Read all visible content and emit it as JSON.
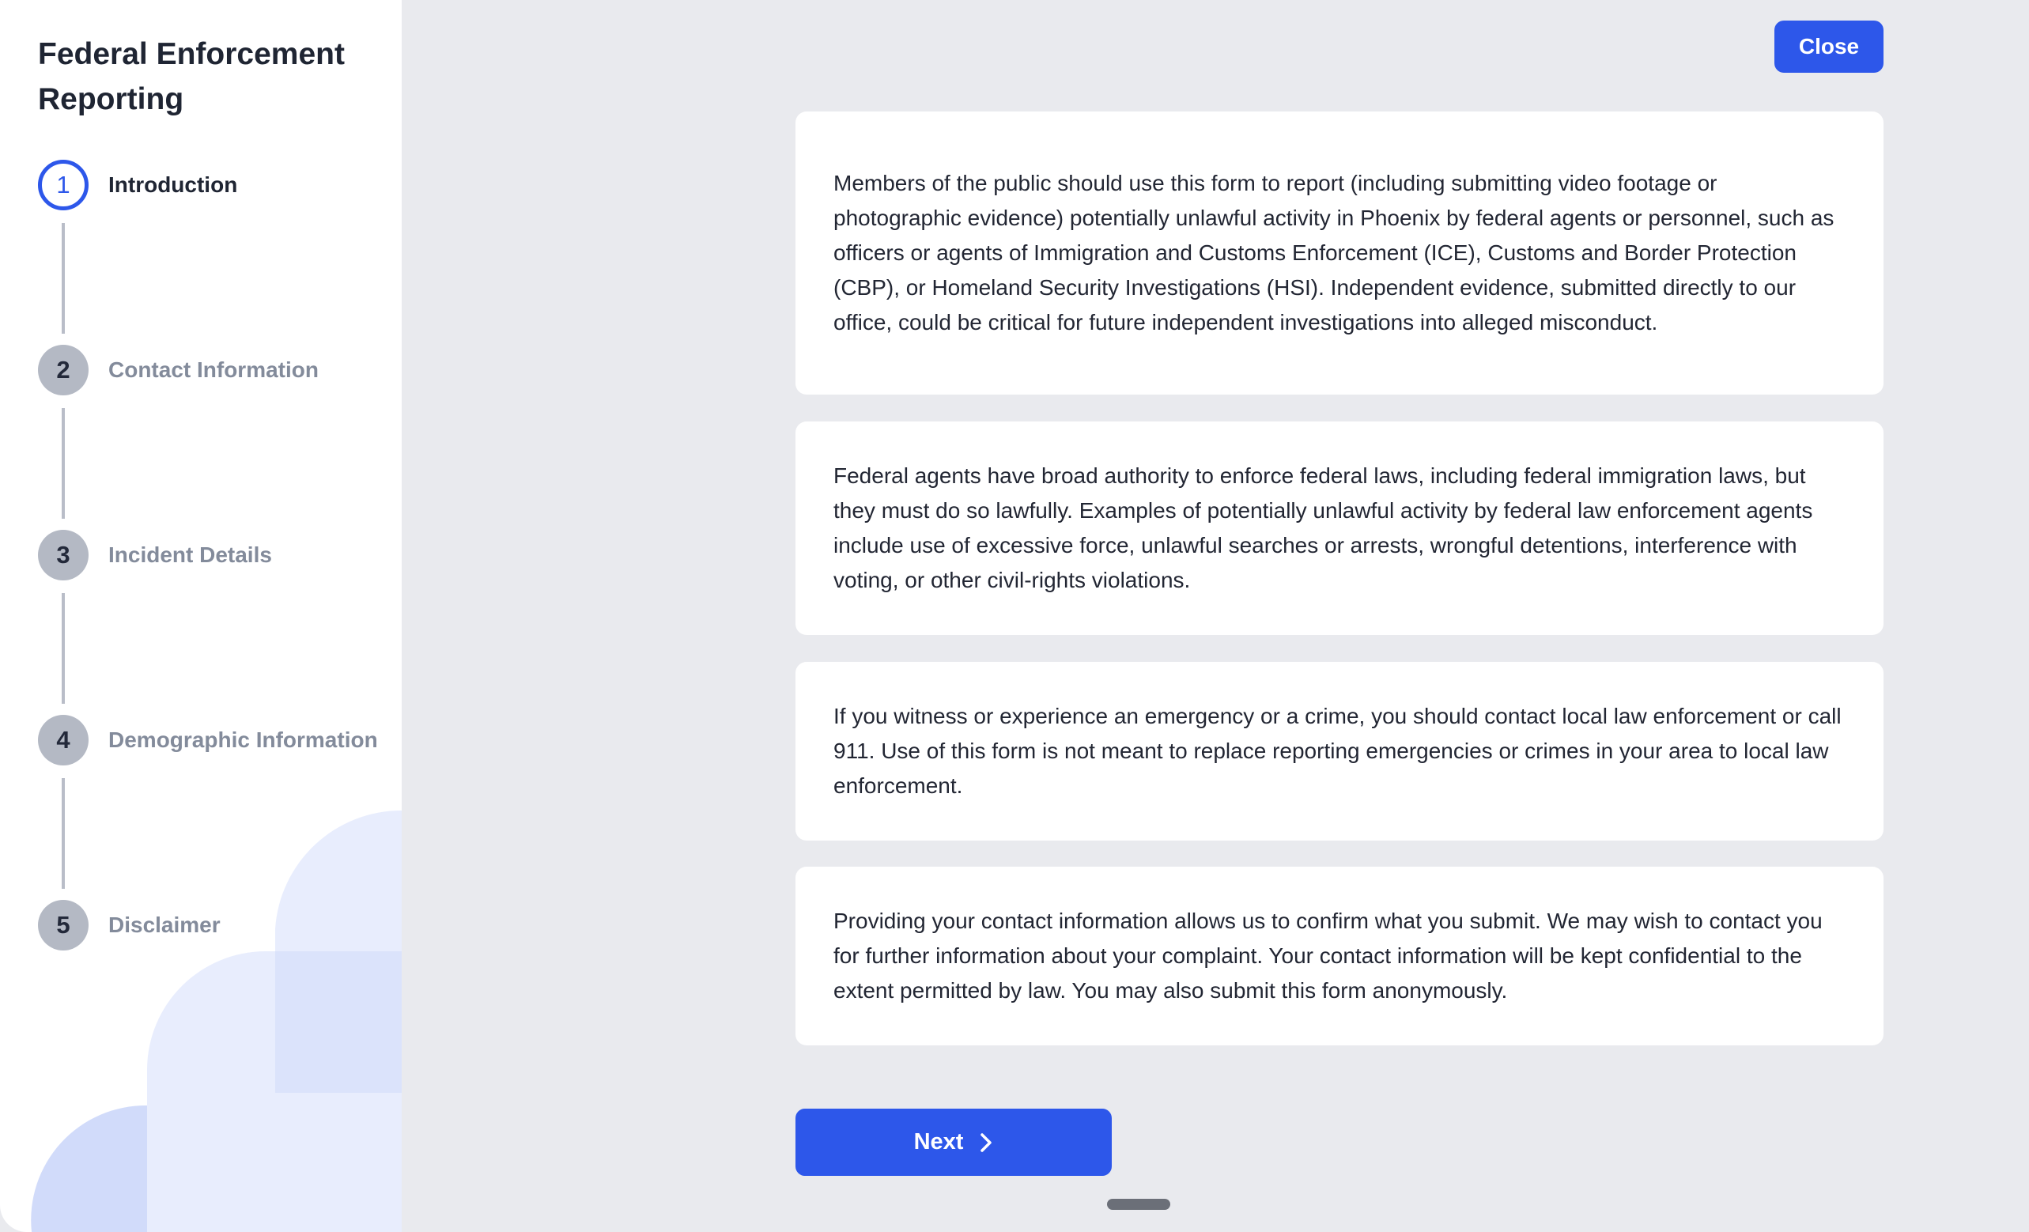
{
  "sidebar": {
    "title": "Federal Enforcement Reporting",
    "steps": [
      {
        "number": "1",
        "label": "Introduction",
        "state": "active"
      },
      {
        "number": "2",
        "label": "Contact Information",
        "state": "inactive"
      },
      {
        "number": "3",
        "label": "Incident Details",
        "state": "inactive"
      },
      {
        "number": "4",
        "label": "Demographic Information",
        "state": "inactive"
      },
      {
        "number": "5",
        "label": "Disclaimer",
        "state": "inactive"
      }
    ]
  },
  "header": {
    "close_label": "Close"
  },
  "main": {
    "paragraphs": [
      "Members of the public should use this form to report (including submitting video footage or photographic evidence) potentially unlawful activity in Phoenix by federal agents or personnel, such as officers or agents of Immigration and Customs Enforcement (ICE), Customs and Border Protection (CBP), or Homeland Security Investigations (HSI). Independent evidence, submitted directly to our office, could be critical for future independent investigations into alleged misconduct.",
      "Federal agents have broad authority to enforce federal laws, including federal immigration laws, but they must do so lawfully. Examples of potentially unlawful activity by federal law enforcement agents include use of excessive force, unlawful searches or arrests, wrongful detentions, interference with voting, or other civil-rights violations.",
      "If you witness or experience an emergency or a crime, you should contact local law enforcement or call 911. Use of this form is not meant to replace reporting emergencies or crimes in your area to local law enforcement.",
      "Providing your contact information allows us to confirm what you submit. We may wish to contact you for further information about your complaint. Your contact information will be kept confidential to the extent permitted by law. You may also submit this form anonymously."
    ],
    "next_label": "Next"
  },
  "icons": {
    "next": "chevron-right-icon"
  },
  "colors": {
    "accent": "#2d57ea",
    "background": "#e9eaee",
    "inactive_step": "#b4b9c4"
  }
}
